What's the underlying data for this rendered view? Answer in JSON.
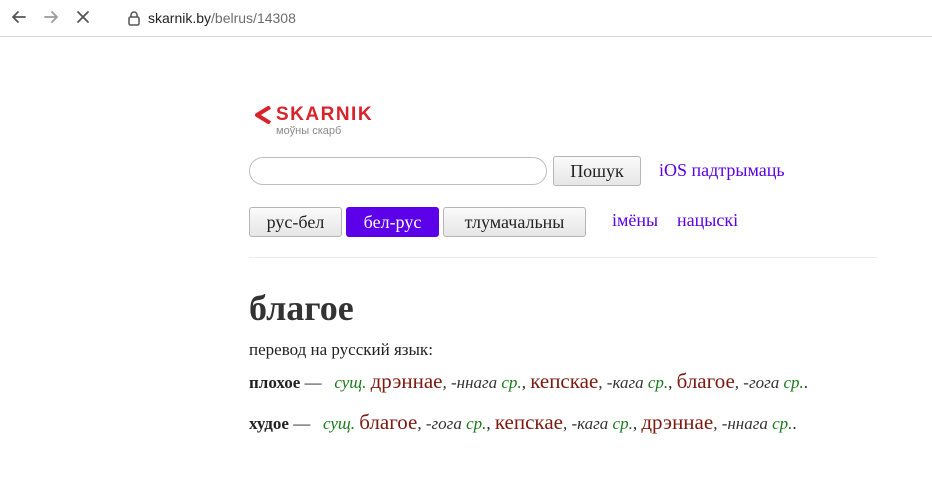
{
  "browser": {
    "url_host": "skarnik.by",
    "url_path": "/belrus/14308"
  },
  "logo": {
    "word": "SKARNIK",
    "tagline": "моўны скарб"
  },
  "search": {
    "value": "",
    "button_label": "Пошук",
    "ios_link": "iOS падтрымаць"
  },
  "tabs": [
    {
      "label": "рус-бел",
      "active": false
    },
    {
      "label": "бел-рус",
      "active": true
    },
    {
      "label": "тлумачальны",
      "active": false
    }
  ],
  "extra_links": [
    "імёны",
    "нацыскі"
  ],
  "article": {
    "headword": "благое",
    "subtitle": "перевод на русский язык:",
    "entries": [
      {
        "lemma": "плохое",
        "dash": " — ",
        "pos": "сущ.",
        "parts": [
          {
            "word": "дрэннае",
            "infl": ", -ннага ",
            "gender": "ср.",
            "sep": ", "
          },
          {
            "word": "кепскае",
            "infl": ", -кага ",
            "gender": "ср.",
            "sep": ", "
          },
          {
            "word": "благое",
            "infl": ", -гога ",
            "gender": "ср.",
            "sep": "."
          }
        ]
      },
      {
        "lemma": "худое",
        "dash": " — ",
        "pos": "сущ.",
        "parts": [
          {
            "word": "благое",
            "infl": ", -гога ",
            "gender": "ср.",
            "sep": ", "
          },
          {
            "word": "кепскае",
            "infl": ", -кага ",
            "gender": "ср.",
            "sep": ", "
          },
          {
            "word": "дрэннае",
            "infl": ", -ннага ",
            "gender": "ср.",
            "sep": "."
          }
        ]
      }
    ]
  },
  "colors": {
    "accent": "#5b00e8",
    "brand": "#d8232a",
    "pos_green": "#1a7a1a",
    "translation": "#7a1a10"
  }
}
